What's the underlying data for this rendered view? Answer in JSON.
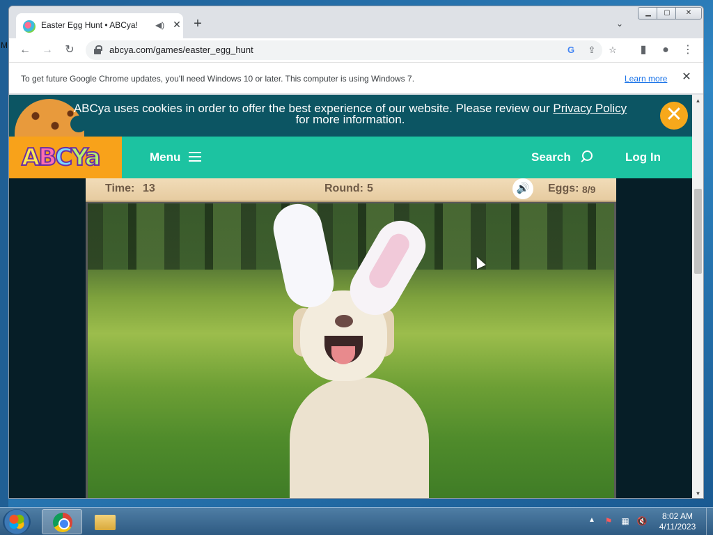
{
  "desktop": {
    "partial_letter": "M"
  },
  "browser": {
    "tab": {
      "title": "Easter Egg Hunt • ABCya!",
      "audio_icon": "speaker-icon",
      "close": "✕"
    },
    "new_tab": "+",
    "tab_search_icon": "chevron-down-icon",
    "window_controls": {
      "minimize": "▁",
      "maximize": "▢",
      "close": "✕"
    },
    "nav": {
      "back": "←",
      "forward": "→",
      "reload": "↻"
    },
    "url": "abcya.com/games/easter_egg_hunt",
    "omnibox_icons": [
      "google-icon",
      "share-icon",
      "star-icon"
    ],
    "toolbar_icons": {
      "side_panel": "▮",
      "profile": "●",
      "menu": "⋮"
    },
    "infobar": {
      "text": "To get future Google Chrome updates, you'll need Windows 10 or later. This computer is using Windows 7.",
      "link": "Learn more",
      "close": "✕"
    }
  },
  "page": {
    "cookie_banner": {
      "text_before": "ABCya uses cookies in order to offer the best experience of our website. Please review our ",
      "link": "Privacy Policy",
      "text_after": "for more information.",
      "close": "✕"
    },
    "site_nav": {
      "logo": {
        "a": "A",
        "b": "B",
        "c": "C",
        "y": "Ya"
      },
      "menu": "Menu",
      "search": "Search",
      "login": "Log In"
    },
    "game": {
      "time_label": "Time:",
      "time_value": "13",
      "round_label": "Round:",
      "round_value": "5",
      "eggs_label": "Eggs:",
      "eggs_value": "8/9",
      "sound_icon": "🔊"
    }
  },
  "taskbar": {
    "apps": [
      "chrome-icon",
      "explorer-icon"
    ],
    "tray": {
      "arrow": "▲",
      "icons": [
        "flag-icon",
        "network-icon",
        "volume-muted-icon"
      ]
    },
    "clock": {
      "time": "8:02 AM",
      "date": "4/11/2023"
    }
  },
  "scrollbar": {
    "up": "▲",
    "down": "▼"
  }
}
